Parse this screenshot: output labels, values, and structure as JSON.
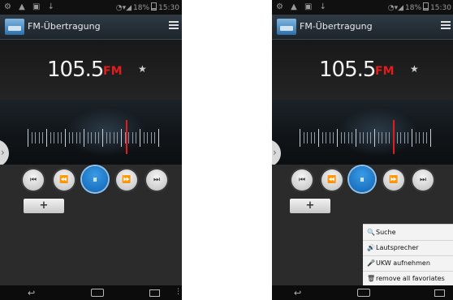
{
  "status_bar": {
    "left_icons": "⚙ ▲ ▣ ↓",
    "battery": "18%",
    "time_partial": "15:30"
  },
  "app": {
    "title": "FM-Übertragung",
    "app_icon": "radio-app-icon",
    "menu_icon": "list-menu-icon"
  },
  "radio": {
    "frequency": "105.5",
    "band": "FM",
    "favorite_icon": "★"
  },
  "controls": {
    "prev_station": "⏮",
    "rewind": "⏪",
    "pause": "⏸",
    "forward": "⏩",
    "next_station": "⏭",
    "add_label": "+"
  },
  "navbar": {
    "back": "↩",
    "menu": "⋮"
  },
  "popup_menu": {
    "items": [
      {
        "icon": "search-icon",
        "glyph": "🔍",
        "label": "Suche"
      },
      {
        "icon": "speaker-icon",
        "glyph": "🔊",
        "label": "Lautsprecher"
      },
      {
        "icon": "microphone-icon",
        "glyph": "🎤",
        "label": "UKW aufnehmen"
      },
      {
        "icon": "trash-icon",
        "glyph": "🗑",
        "label": "remove all favoriates"
      }
    ]
  },
  "colors": {
    "accent_red": "#e11d1d",
    "play_blue": "#0f63b3",
    "actionbar": "#2f3a44"
  }
}
